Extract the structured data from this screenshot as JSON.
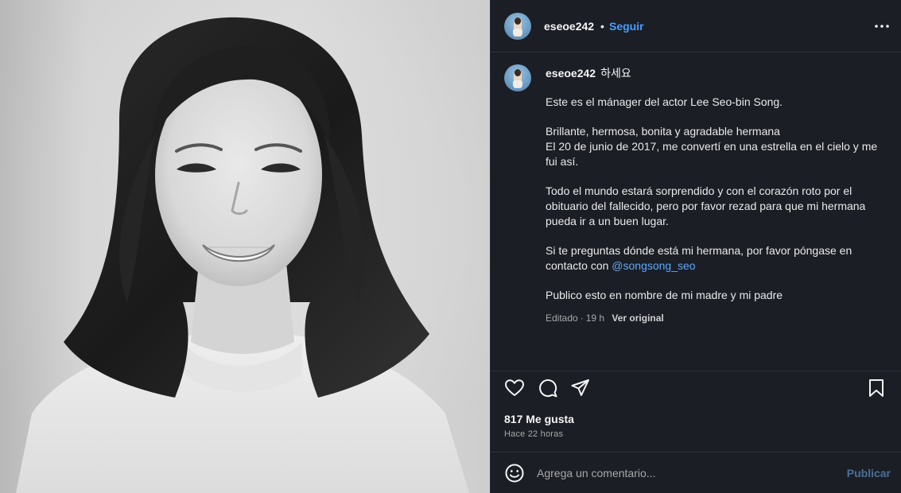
{
  "post": {
    "photo_alt": "",
    "author": {
      "username": "eseoe242",
      "separator": "•",
      "follow_label": "Seguir"
    },
    "caption": {
      "username": "eseoe242",
      "first_line": "하세요",
      "paragraphs": [
        "Este es el mánager del actor Lee Seo-bin Song.",
        "Brillante, hermosa, bonita y agradable hermana\nEl 20 de junio de 2017, me convertí en una estrella en el cielo y me fui así.",
        "Todo el mundo estará sorprendido y con el corazón roto por el obituario del fallecido, pero por favor rezad para que mi hermana pueda ir a un buen lugar."
      ],
      "contact_text": "Si te preguntas dónde está mi hermana, por favor póngase en contacto con ",
      "contact_mention": "@songsong_seo",
      "closing": "Publico esto en nombre de mi madre y mi padre",
      "edited_label": "Editado",
      "meta_sep": "·",
      "age": "19 h",
      "see_original": "Ver original"
    },
    "likes": "817 Me gusta",
    "timestamp": "Hace 22 horas",
    "comment": {
      "placeholder": "Agrega un comentario...",
      "publish_label": "Publicar"
    },
    "icons": {
      "more": "more-options-icon",
      "like": "heart-icon",
      "comment": "comment-icon",
      "share": "share-icon",
      "save": "bookmark-icon",
      "emoji": "emoji-icon"
    },
    "colors": {
      "panel_bg": "#1b1e25",
      "accent_link": "#4a9df8",
      "muted_text": "#a8a8a8",
      "publish_disabled": "#48709a"
    }
  }
}
